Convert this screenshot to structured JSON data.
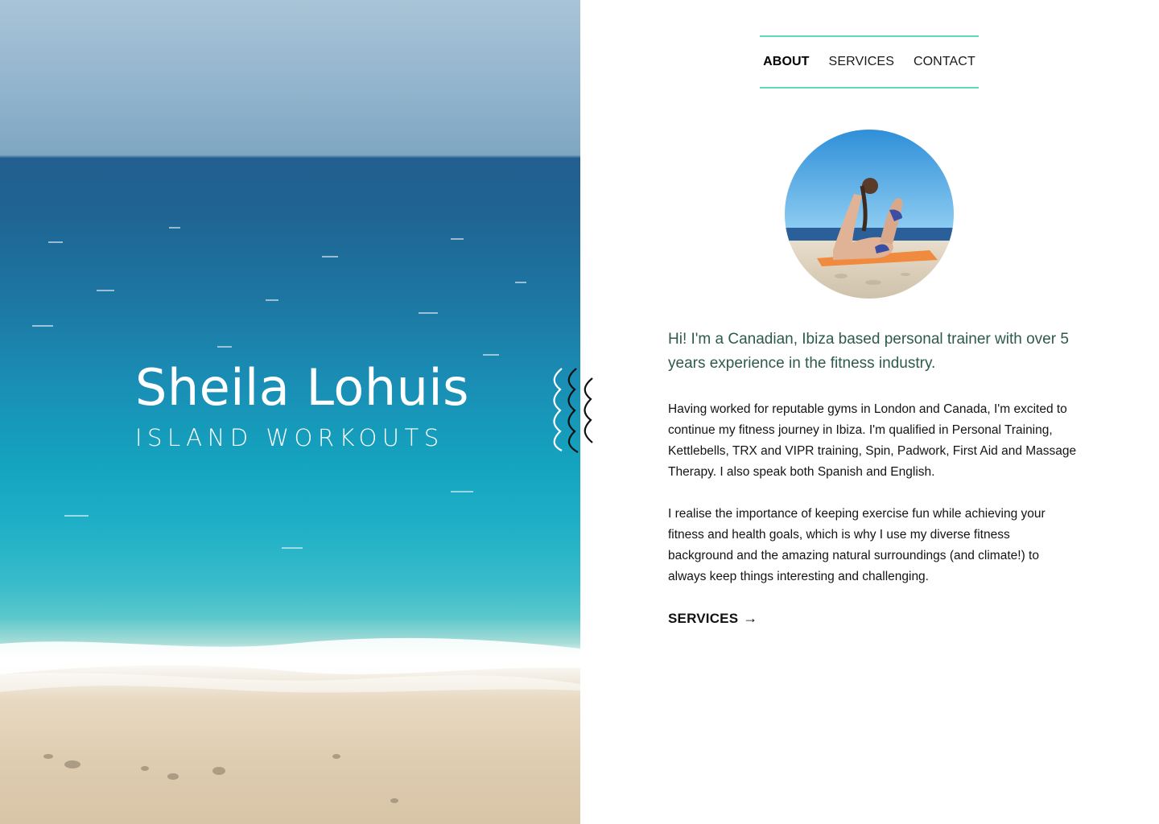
{
  "hero": {
    "title": "Sheila Lohuis",
    "subtitle": "ISLAND WORKOUTS"
  },
  "nav": {
    "items": [
      {
        "label": "ABOUT",
        "active": true
      },
      {
        "label": "SERVICES",
        "active": false
      },
      {
        "label": "CONTACT",
        "active": false
      }
    ]
  },
  "about": {
    "intro": "Hi! I'm a Canadian, Ibiza based personal trainer with over 5 years experience in the fitness industry.",
    "paragraphs": [
      "Having worked for reputable gyms in London and Canada, I'm excited to continue my fitness journey in Ibiza. I'm qualified in Personal Training, Kettlebells, TRX and VIPR training, Spin, Padwork, First Aid and Massage Therapy. I also speak both Spanish and English.",
      "I realise the importance of keeping exercise fun while achieving your fitness and health goals, which is why I use my diverse fitness background and the amazing natural surroundings (and climate!) to always keep things interesting and challenging."
    ],
    "cta_label": "SERVICES",
    "cta_arrow": "→"
  },
  "colors": {
    "accent": "#5fd8c0",
    "intro_text": "#2d5a4d",
    "body_text": "#141414"
  },
  "icons": {
    "squiggle": "wavy-lines-icon",
    "arrow": "arrow-right-icon"
  }
}
